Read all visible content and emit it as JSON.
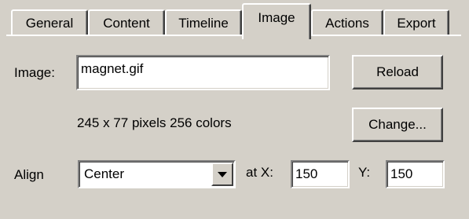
{
  "tabs": [
    {
      "label": "General",
      "active": false
    },
    {
      "label": "Content",
      "active": false
    },
    {
      "label": "Timeline",
      "active": false
    },
    {
      "label": "Image",
      "active": true
    },
    {
      "label": "Actions",
      "active": false
    },
    {
      "label": "Export",
      "active": false
    }
  ],
  "image": {
    "label": "Image:",
    "value": "magnet.gif",
    "reload_label": "Reload",
    "info": "245 x 77 pixels 256 colors",
    "change_label": "Change..."
  },
  "align": {
    "label": "Align",
    "selected": "Center",
    "x_label": "at X:",
    "x_value": "150",
    "y_label": "Y:",
    "y_value": "150"
  }
}
